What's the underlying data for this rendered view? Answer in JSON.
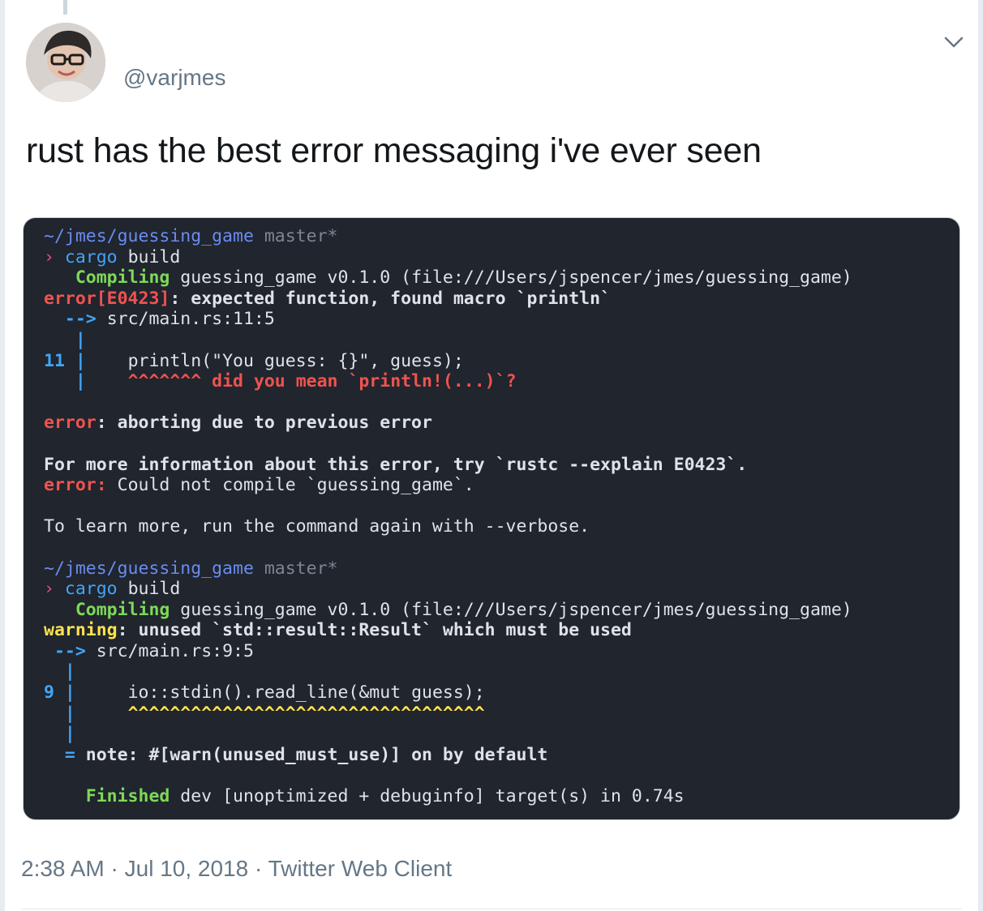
{
  "tweet": {
    "handle": "@varjmes",
    "text": "rust has the best error messaging i've ever seen",
    "time": "2:38 AM",
    "date": "Jul 10, 2018",
    "client": "Twitter Web Client",
    "separator": " · "
  },
  "icons": {
    "caret": "chevron-down-icon",
    "avatar": "avatar"
  },
  "colors": {
    "terminal_bg": "#20252e",
    "error": "#ef5350",
    "green": "#7ed957",
    "warning": "#ffe14d",
    "gutter": "#42a5f5",
    "path": "#6a8cf0"
  },
  "terminal": {
    "l1": {
      "path": "~/jmes/guessing_game",
      "branch": "master*"
    },
    "l2": {
      "prompt": "›",
      "cmd": "cargo",
      "arg": "build"
    },
    "l3": {
      "kw": "Compiling",
      "rest": "guessing_game v0.1.0 (file:///Users/jspencer/jmes/guessing_game)"
    },
    "l4": {
      "err": "error[E0423]",
      "msg": ": expected function, found macro `println`"
    },
    "l5": {
      "arrow": "-->",
      "loc": "src/main.rs:11:5"
    },
    "l6": {
      "bar": "|"
    },
    "l7": {
      "num": "11",
      "bar": "|",
      "code": "println(\"You guess: {}\", guess);"
    },
    "l8": {
      "bar": "|",
      "carets": "^^^^^^^",
      "hint": "did you mean `println!(...)`?"
    },
    "l10": {
      "err": "error",
      "msg": ": aborting due to previous error"
    },
    "l12": {
      "text": "For more information about this error, try `rustc --explain E0423`."
    },
    "l13": {
      "err": "error:",
      "msg": "Could not compile `guessing_game`."
    },
    "l15": {
      "text": "To learn more, run the command again with --verbose."
    },
    "l17": {
      "path": "~/jmes/guessing_game",
      "branch": "master*"
    },
    "l18": {
      "prompt": "›",
      "cmd": "cargo",
      "arg": "build"
    },
    "l19": {
      "kw": "Compiling",
      "rest": "guessing_game v0.1.0 (file:///Users/jspencer/jmes/guessing_game)"
    },
    "l20": {
      "warn": "warning",
      "msg": ": unused `std::result::Result` which must be used"
    },
    "l21": {
      "arrow": "-->",
      "loc": "src/main.rs:9:5"
    },
    "l22": {
      "bar": "|"
    },
    "l23": {
      "num": "9",
      "bar": "|",
      "code": "io::stdin().read_line(&mut guess);"
    },
    "l24": {
      "bar": "|",
      "carets": "^^^^^^^^^^^^^^^^^^^^^^^^^^^^^^^^^^"
    },
    "l25": {
      "bar": "|"
    },
    "l26": {
      "eq": "=",
      "msg": "note: #[warn(unused_must_use)] on by default"
    },
    "l28": {
      "kw": "Finished",
      "rest": "dev [unoptimized + debuginfo] target(s) in 0.74s"
    }
  }
}
